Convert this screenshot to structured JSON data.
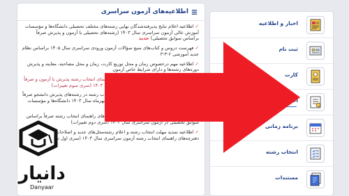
{
  "announcements": {
    "title": "اطلاعیه‌های آزمون سراسری",
    "items": [
      {
        "text": "اطلاعیه اعلام نتایج پذیرفته‌شدگان نهایی رشته‌های مختلف تحصیلی دانشگاه‌ها و مؤسسات آموزش عالی آزمون سراسری سال ۱۴۰۳ (رشته‌های تحصیلی با آزمون و پذیرش صرفاً براساس سوابق تحصیلی)",
        "badge": "جدید"
      },
      {
        "text": "فهرست دروس و کتاب‌های منبع سؤالات آزمون ورودی سراسری سال ۱۴۰۵ براساس نظام جدید آموزشی ۶-۳-۳",
        "badge": ""
      },
      {
        "text": "اطلاعیه مهم درخصوص زمان و محل توزیع کارت، زمان و محل مصاحبه، معاینه و پذیرش دوره‌های رشته‌ها و دارای شرایط خاص آزمون",
        "badge": ""
      },
      {
        "text": "رشته‌محل‌های جدید و اصلاحات دفترچه‌های راهنمای انتخاب رشته پذیرش با آزمون و صرفاً براساس سوابق تحصیلی در آزمون سراسری سال ۱۴۰۳ (سری سوم تغییرات)",
        "badge": ""
      },
      {
        "text": "اطلاعیه تمدید مجدد مهلت زمان ثبت نام و انتخاب رشته در رشته‌های پذیرش دانشجو صرفاً بر اساس سوابق تحصیلی (بدون آزمون) نیمسال مهرماه سال ۱۴۰۳ دانشگاه‌ها و مؤسسات آموزش عالی",
        "badge": ""
      },
      {
        "text": "اطلاعیه رشته‌محل‌های جدید و اصلاحات دفترچه‌های راهنمای انتخاب رشته صرفاً براساس سوابق تحصیلی در آزمون سراسری سال ۱۴۰۳ (سری دوم تغییرات)",
        "badge": ""
      },
      {
        "text": "اطلاعیه تمدید مهلت انتخاب رشته و اعلام رشته‌محل‌های جدید و اصلاحات مربوط به دفترچه‌های راهنمای انتخاب رشته آزمون سراسری سال ۱۴۰۳ (سری اول تغییرات)",
        "badge": ""
      }
    ]
  },
  "services": [
    {
      "label": "اخبار و اطلاعیه",
      "icon": "news-icon"
    },
    {
      "label": "ثبت نام",
      "icon": "register-icon"
    },
    {
      "label": "کارت",
      "icon": "card-icon"
    },
    {
      "label": "اعلام نتایج",
      "icon": "results-icon"
    },
    {
      "label": "برنامه زمانی",
      "icon": "calendar-icon"
    },
    {
      "label": "انتخاب رشته",
      "icon": "course-selection-icon"
    },
    {
      "label": "مستندات",
      "icon": "documents-icon"
    }
  ],
  "watermark": {
    "brand_fa": "دانیار",
    "brand_en": "Danyaar"
  },
  "colors": {
    "accent": "#1f3f88",
    "alert": "#d63a4a",
    "arrow": "#ee1c25"
  }
}
